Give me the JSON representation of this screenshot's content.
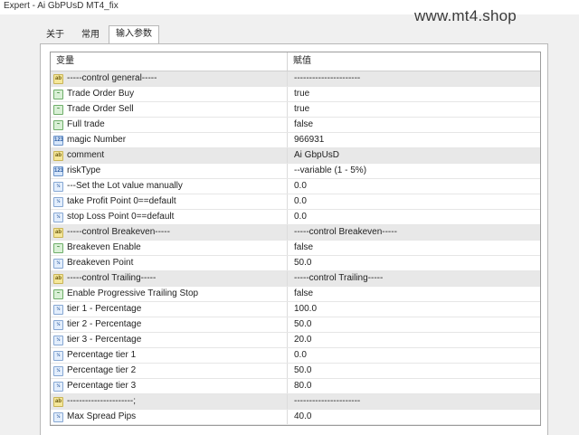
{
  "window": {
    "title": "Expert - Ai GbPUsD MT4_fix"
  },
  "watermark": "www.mt4.shop",
  "tabs": [
    {
      "label": "关于"
    },
    {
      "label": "常用"
    },
    {
      "label": "输入参数"
    }
  ],
  "table": {
    "headers": {
      "variable": "变量",
      "value": "赋值"
    },
    "rows": [
      {
        "icon": "string-icon",
        "glyph": "ab",
        "name": "-----control general-----",
        "value": "----------------------"
      },
      {
        "icon": "bool-icon",
        "glyph": "~",
        "name": "Trade Order Buy",
        "value": "true"
      },
      {
        "icon": "bool-icon",
        "glyph": "~",
        "name": "Trade Order Sell",
        "value": "true"
      },
      {
        "icon": "bool-icon",
        "glyph": "~",
        "name": "Full trade",
        "value": "false"
      },
      {
        "icon": "integer-icon",
        "glyph": "123",
        "name": "magic Number",
        "value": "966931"
      },
      {
        "icon": "string-icon",
        "glyph": "ab",
        "name": "comment",
        "value": "Ai GbpUsD"
      },
      {
        "icon": "integer-icon",
        "glyph": "123",
        "name": "riskType",
        "value": "--variable (1 - 5%)"
      },
      {
        "icon": "double-icon",
        "glyph": "½",
        "name": "---Set the Lot value manually",
        "value": "0.0"
      },
      {
        "icon": "double-icon",
        "glyph": "½",
        "name": "take Profit Point 0==default",
        "value": "0.0"
      },
      {
        "icon": "double-icon",
        "glyph": "½",
        "name": "stop Loss Point  0==default",
        "value": "0.0"
      },
      {
        "icon": "string-icon",
        "glyph": "ab",
        "name": "-----control Breakeven-----",
        "value": "-----control Breakeven-----"
      },
      {
        "icon": "bool-icon",
        "glyph": "~",
        "name": "Breakeven Enable",
        "value": "false"
      },
      {
        "icon": "double-icon",
        "glyph": "½",
        "name": "Breakeven Point",
        "value": "50.0"
      },
      {
        "icon": "string-icon",
        "glyph": "ab",
        "name": "-----control Trailing-----",
        "value": "-----control Trailing-----"
      },
      {
        "icon": "bool-icon",
        "glyph": "~",
        "name": "Enable Progressive Trailing Stop",
        "value": "false"
      },
      {
        "icon": "double-icon",
        "glyph": "½",
        "name": "tier 1 - Percentage",
        "value": "100.0"
      },
      {
        "icon": "double-icon",
        "glyph": "½",
        "name": "tier 2 - Percentage",
        "value": "50.0"
      },
      {
        "icon": "double-icon",
        "glyph": "½",
        "name": "tier 3 - Percentage",
        "value": "20.0"
      },
      {
        "icon": "double-icon",
        "glyph": "½",
        "name": "Percentage tier 1",
        "value": "0.0"
      },
      {
        "icon": "double-icon",
        "glyph": "½",
        "name": "Percentage tier 2",
        "value": "50.0"
      },
      {
        "icon": "double-icon",
        "glyph": "½",
        "name": "Percentage tier 3",
        "value": "80.0"
      },
      {
        "icon": "string-icon",
        "glyph": "ab",
        "name": "----------------------;",
        "value": "----------------------"
      },
      {
        "icon": "double-icon",
        "glyph": "½",
        "name": "Max Spread Pips",
        "value": "40.0"
      }
    ]
  }
}
